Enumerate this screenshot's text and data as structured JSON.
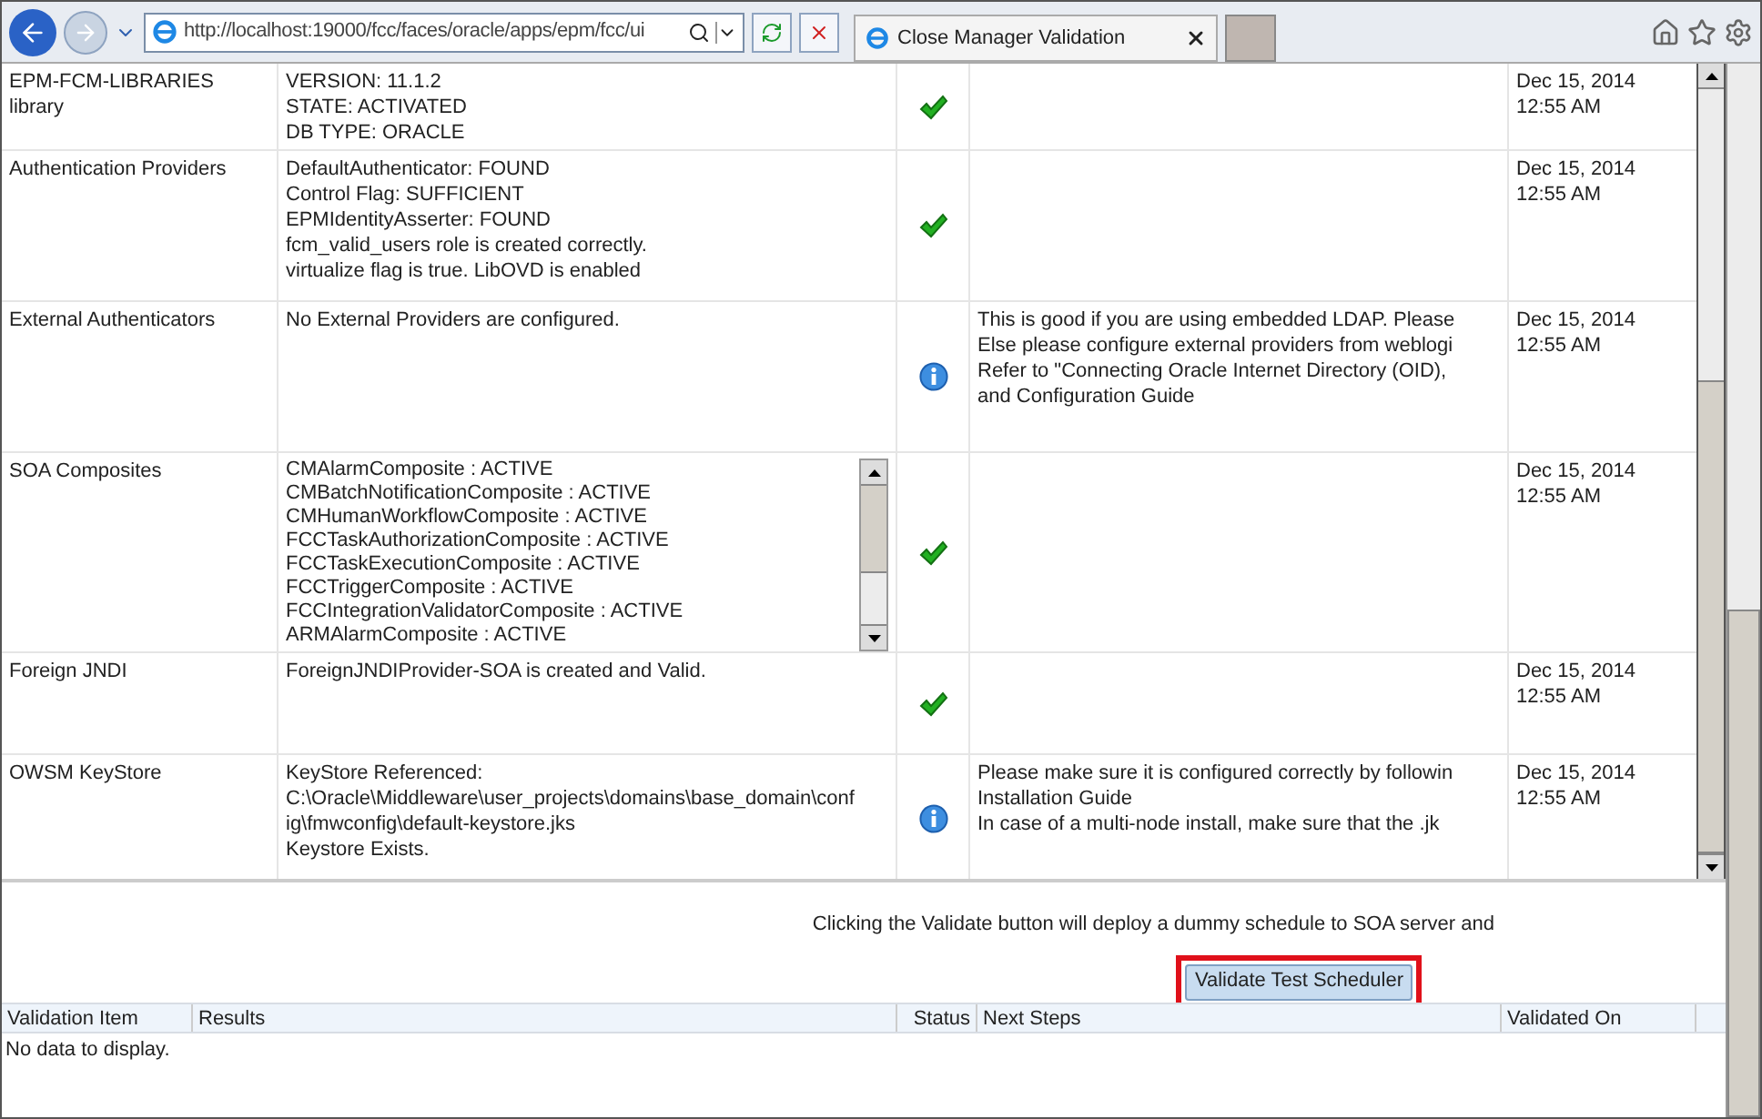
{
  "browser": {
    "address": "http://localhost:19000/fcc/faces/oracle/apps/epm/fcc/ui",
    "tab_title": "Close Manager Validation"
  },
  "results_table": {
    "rows": [
      {
        "item": [
          "EPM-FCM-LIBRARIES",
          "library"
        ],
        "results": [
          "VERSION: 11.1.2",
          "STATE: ACTIVATED",
          "DB TYPE: ORACLE"
        ],
        "status": {
          "kind": "ok"
        },
        "validated_on": [
          "Dec 15, 2014",
          "12:55 AM"
        ]
      },
      {
        "item": [
          "Authentication Providers"
        ],
        "results": [
          "DefaultAuthenticator: FOUND",
          "Control Flag: SUFFICIENT",
          "EPMIdentityAsserter: FOUND",
          "fcm_valid_users role is created correctly.",
          "virtualize flag is true. LibOVD is enabled"
        ],
        "status": {
          "kind": "ok"
        },
        "validated_on": [
          "Dec 15, 2014",
          "12:55 AM"
        ]
      },
      {
        "item": [
          "External Authenticators"
        ],
        "results": [
          "No External Providers are configured."
        ],
        "status": {
          "kind": "info"
        },
        "next_steps": [
          "This is good if you are using embedded LDAP. Please",
          "Else please configure external providers from weblogi",
          "Refer to \"Connecting Oracle Internet Directory (OID),",
          "and Configuration Guide"
        ],
        "validated_on": [
          "Dec 15, 2014",
          "12:55 AM"
        ]
      },
      {
        "item": [
          "SOA Composites"
        ],
        "kind": "scroll",
        "results": [
          "CMAlarmComposite : ACTIVE",
          "CMBatchNotificationComposite : ACTIVE",
          "CMHumanWorkflowComposite : ACTIVE",
          "FCCTaskAuthorizationComposite : ACTIVE",
          "FCCTaskExecutionComposite : ACTIVE",
          "FCCTriggerComposite : ACTIVE",
          "FCCIntegrationValidatorComposite : ACTIVE",
          "ARMAlarmComposite : ACTIVE"
        ],
        "status": {
          "kind": "ok"
        },
        "validated_on": [
          "Dec 15, 2014",
          "12:55 AM"
        ]
      },
      {
        "item": [
          "Foreign JNDI"
        ],
        "results": [
          "ForeignJNDIProvider-SOA is created and Valid."
        ],
        "status": {
          "kind": "ok"
        },
        "validated_on": [
          "Dec 15, 2014",
          "12:55 AM"
        ]
      },
      {
        "item": [
          "OWSM KeyStore"
        ],
        "results": [
          "KeyStore Referenced:",
          "C:\\Oracle\\Middleware\\user_projects\\domains\\base_domain\\conf",
          "ig\\fmwconfig\\default-keystore.jks",
          "Keystore Exists."
        ],
        "status": {
          "kind": "info"
        },
        "next_steps": [
          "Please make sure it is configured correctly by followin",
          "Installation Guide",
          "In case of a multi-node install, make sure that the .jk"
        ],
        "validated_on": [
          "Dec 15, 2014",
          "12:55 AM"
        ]
      }
    ]
  },
  "scheduler": {
    "note": "Clicking the Validate button will deploy a dummy schedule to SOA server and",
    "button": "Validate Test Scheduler"
  },
  "scheduler_table": {
    "columns": [
      "Validation Item",
      "Results",
      "Status",
      "Next Steps",
      "Validated On"
    ],
    "empty_text": "No data to display."
  }
}
